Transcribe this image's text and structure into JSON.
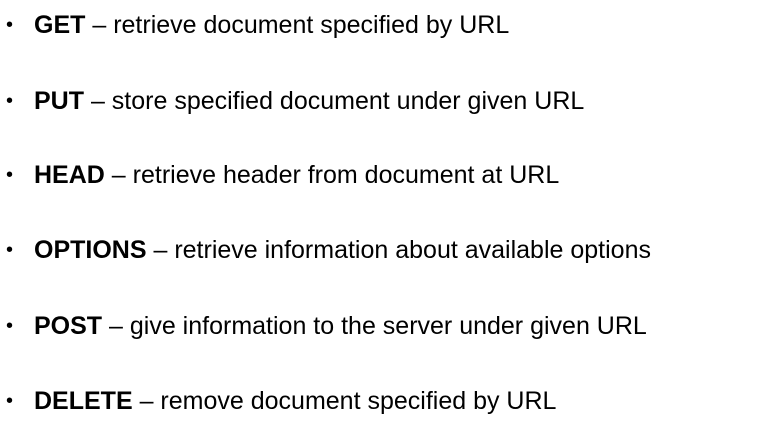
{
  "bullet": "•",
  "items": [
    {
      "method": "GET",
      "sep": " – ",
      "description": "retrieve document specified by URL"
    },
    {
      "method": "PUT",
      "sep": " – ",
      "description": "store specified document under given URL"
    },
    {
      "method": "HEAD",
      "sep": " – ",
      "description": "retrieve header from document at URL"
    },
    {
      "method": "OPTIONS",
      "sep": " – ",
      "description": "retrieve information about available options"
    },
    {
      "method": "POST",
      "sep": " – ",
      "description": "give information to the server under given URL"
    },
    {
      "method": "DELETE",
      "sep": " – ",
      "description": "remove document specified by URL"
    }
  ]
}
